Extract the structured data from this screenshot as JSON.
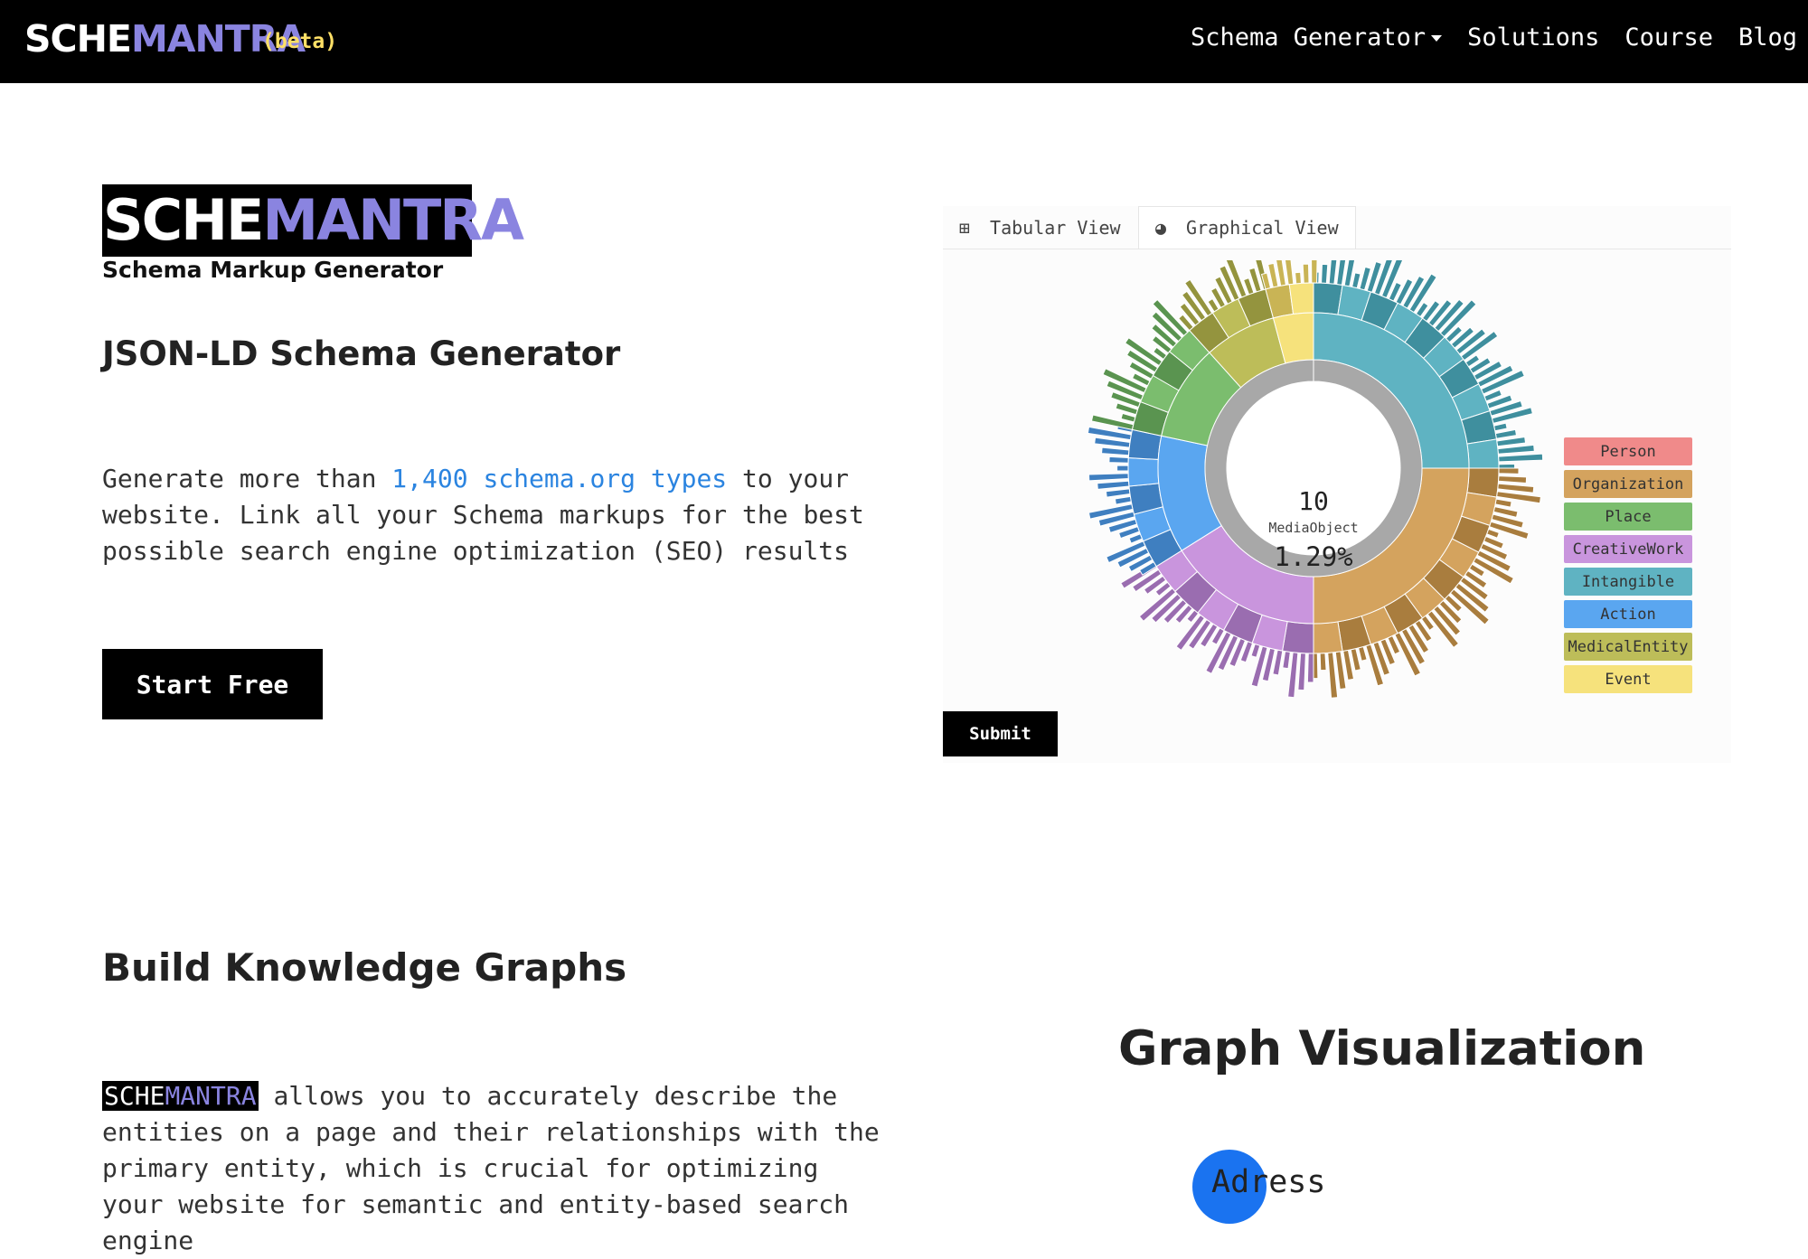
{
  "nav": {
    "brand_a": "SCHE",
    "brand_b": "MANTRA",
    "beta": "(beta)",
    "links": [
      "Schema Generator",
      "Solutions",
      "Course",
      "Blog"
    ]
  },
  "hero": {
    "logo_a": "SCHE",
    "logo_b": "MANTRA",
    "subtitle": "Schema Markup Generator",
    "heading": "JSON-LD Schema Generator",
    "text_before": "Generate more than ",
    "link": "1,400 schema.org types",
    "text_after": " to your website. Link all your Schema markups for the best possible search engine optimization (SEO) results",
    "cta": "Start Free"
  },
  "widget": {
    "tabs": [
      {
        "label": "Tabular View",
        "icon": "table-icon"
      },
      {
        "label": "Graphical View",
        "icon": "pie-icon"
      }
    ],
    "center": {
      "count": "10",
      "type": "MediaObject",
      "percent": "1.29%"
    },
    "legend": [
      {
        "label": "Person",
        "color": "#f08a8a"
      },
      {
        "label": "Organization",
        "color": "#d4a35e"
      },
      {
        "label": "Place",
        "color": "#7bbd6e"
      },
      {
        "label": "CreativeWork",
        "color": "#c995dd"
      },
      {
        "label": "Intangible",
        "color": "#5fb3c2"
      },
      {
        "label": "Action",
        "color": "#5aa6f0"
      },
      {
        "label": "MedicalEntity",
        "color": "#bdbd59"
      },
      {
        "label": "Event",
        "color": "#f6e27c"
      }
    ],
    "submit": "Submit"
  },
  "section2": {
    "heading": "Build Knowledge Graphs",
    "logo_a": "SCHE",
    "logo_b": "MANTRA",
    "text": " allows you to accurately describe the entities on a page and their relationships with the primary entity, which is crucial for optimizing your website for semantic and entity-based search engine",
    "gv_title": "Graph Visualization",
    "node_label": "Adress"
  }
}
